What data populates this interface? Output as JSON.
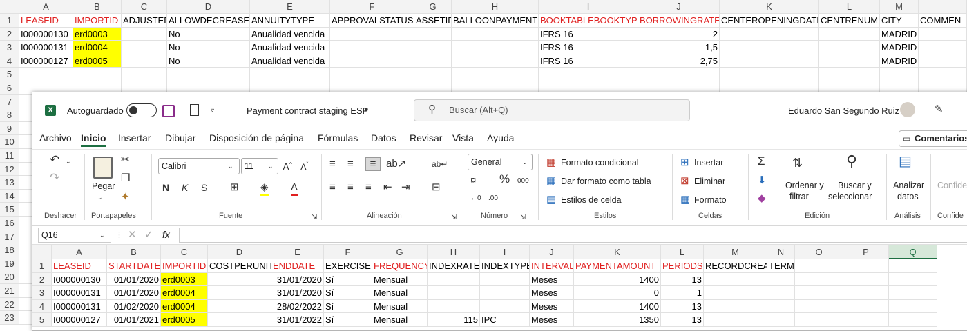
{
  "back_sheet": {
    "columns": [
      "A",
      "B",
      "C",
      "D",
      "E",
      "F",
      "G",
      "H",
      "I",
      "J",
      "K",
      "L",
      "M"
    ],
    "rows": [
      "1",
      "2",
      "3",
      "4",
      "5",
      "6",
      "7",
      "8",
      "9",
      "10",
      "11",
      "12",
      "13",
      "14",
      "15",
      "16",
      "17",
      "18",
      "19",
      "20",
      "21",
      "22",
      "23"
    ],
    "header": [
      "LEASEID",
      "IMPORTID",
      "ADJUSTED",
      "ALLOWDECREASES",
      "ANNUITYTYPE",
      "APPROVALSTATUS",
      "ASSETID",
      "BALLOONPAYMENT",
      "BOOKTABLEBOOKTYPE",
      "BORROWINGRATE",
      "CENTEROPENINGDATE",
      "CENTRENUM",
      "CITY",
      "COMMEN"
    ],
    "data": [
      [
        "I000000130",
        "erd0003",
        "",
        "No",
        "Anualidad vencida",
        "",
        "",
        "",
        "IFRS 16",
        "2",
        "",
        "",
        "MADRID",
        ""
      ],
      [
        "I000000131",
        "erd0004",
        "",
        "No",
        "Anualidad vencida",
        "",
        "",
        "",
        "IFRS 16",
        "1,5",
        "",
        "",
        "MADRID",
        ""
      ],
      [
        "I000000127",
        "erd0005",
        "",
        "No",
        "Anualidad vencida",
        "",
        "",
        "",
        "IFRS 16",
        "2,75",
        "",
        "",
        "MADRID",
        ""
      ]
    ]
  },
  "titlebar": {
    "autosave_label": "Autoguardado",
    "doc_title": "Payment contract staging ESP",
    "search_placeholder": "Buscar (Alt+Q)",
    "user_name": "Eduardo San Segundo Ruiz"
  },
  "tabs": [
    "Archivo",
    "Inicio",
    "Insertar",
    "Dibujar",
    "Disposición de página",
    "Fórmulas",
    "Datos",
    "Revisar",
    "Vista",
    "Ayuda"
  ],
  "comments_label": "Comentarios",
  "ribbon": {
    "undo_group": "Deshacer",
    "paste_label": "Pegar",
    "clipboard_group": "Portapapeles",
    "font_name": "Calibri",
    "font_size": "11",
    "font_group": "Fuente",
    "align_group": "Alineación",
    "number_format": "General",
    "number_group": "Número",
    "cond_format": "Formato condicional",
    "table_format": "Dar formato como tabla",
    "cell_styles": "Estilos de celda",
    "styles_group": "Estilos",
    "insert": "Insertar",
    "delete": "Eliminar",
    "format": "Formato",
    "cells_group": "Celdas",
    "sort_filter_1": "Ordenar y",
    "sort_filter_2": "filtrar",
    "find_select_1": "Buscar y",
    "find_select_2": "seleccionar",
    "edit_group": "Edición",
    "analyze_1": "Analizar",
    "analyze_2": "datos",
    "analysis_group": "Análisis",
    "confid_1": "Confide",
    "confid_group": "Confide"
  },
  "formula_bar": {
    "name_box": "Q16",
    "fx": "fx"
  },
  "front_sheet": {
    "columns": [
      "A",
      "B",
      "C",
      "D",
      "E",
      "F",
      "G",
      "H",
      "I",
      "J",
      "K",
      "L",
      "M",
      "N",
      "O",
      "P",
      "Q"
    ],
    "header": [
      "LEASEID",
      "STARTDATE",
      "IMPORTID",
      "COSTPERUNIT",
      "ENDDATE",
      "EXERCISE",
      "FREQUENCY",
      "INDEXRATE",
      "INDEXTYPE",
      "INTERVAL",
      "PAYMENTAMOUNT",
      "PERIODS",
      "RECORDCREATEDBY",
      "TERM",
      "",
      "",
      ""
    ],
    "data": [
      [
        "I000000130",
        "01/01/2020",
        "erd0003",
        "",
        "31/01/2020",
        "Sí",
        "Mensual",
        "",
        "",
        "Meses",
        "1400",
        "13",
        "",
        "",
        "",
        "",
        ""
      ],
      [
        "I000000131",
        "01/01/2020",
        "erd0004",
        "",
        "31/01/2020",
        "Sí",
        "Mensual",
        "",
        "",
        "Meses",
        "0",
        "1",
        "",
        "",
        "",
        "",
        ""
      ],
      [
        "I000000131",
        "01/02/2020",
        "erd0004",
        "",
        "28/02/2022",
        "Sí",
        "Mensual",
        "",
        "",
        "Meses",
        "1400",
        "13",
        "",
        "",
        "",
        "",
        ""
      ],
      [
        "I000000127",
        "01/01/2021",
        "erd0005",
        "",
        "31/01/2022",
        "Sí",
        "Mensual",
        "115",
        "IPC",
        "Meses",
        "1350",
        "13",
        "",
        "",
        "",
        "",
        ""
      ]
    ]
  }
}
